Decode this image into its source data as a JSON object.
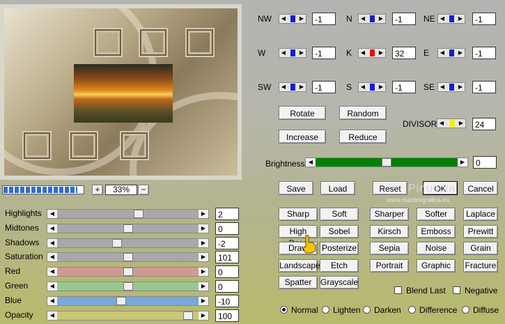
{
  "directions": [
    {
      "id": "nw",
      "label": "NW",
      "value": "-1",
      "color": "#1020d0"
    },
    {
      "id": "n",
      "label": "N",
      "value": "-1",
      "color": "#1020d0"
    },
    {
      "id": "ne",
      "label": "NE",
      "value": "-1",
      "color": "#1020d0"
    },
    {
      "id": "w",
      "label": "W",
      "value": "-1",
      "color": "#1020d0"
    },
    {
      "id": "k",
      "label": "K",
      "value": "32",
      "color": "#e01010"
    },
    {
      "id": "e",
      "label": "E",
      "value": "-1",
      "color": "#1020d0"
    },
    {
      "id": "sw",
      "label": "SW",
      "value": "-1",
      "color": "#1020d0"
    },
    {
      "id": "s",
      "label": "S",
      "value": "-1",
      "color": "#1020d0"
    },
    {
      "id": "se",
      "label": "SE",
      "value": "-1",
      "color": "#1020d0"
    }
  ],
  "actions": {
    "rotate": "Rotate",
    "random": "Random",
    "increase": "Increase",
    "reduce": "Reduce"
  },
  "divisor": {
    "label": "DIVISOR",
    "value": "24",
    "color": "#f0f000"
  },
  "brightness": {
    "label": "Brightness",
    "value": "0",
    "color": "#008000"
  },
  "zoom": {
    "plus": "+",
    "minus": "−",
    "value": "33%",
    "progress": 0.93
  },
  "dialog": {
    "save": "Save",
    "load": "Load",
    "reset": "Reset",
    "ok": "OK",
    "cancel": "Cancel"
  },
  "watermark": {
    "brand": "Pinuccia",
    "site": "www.maidiregrafica.eu"
  },
  "adjustments": [
    {
      "id": "highlights",
      "label": "Highlights",
      "value": "2",
      "track": "#a8a8a8",
      "pos": 0.58
    },
    {
      "id": "midtones",
      "label": "Midtones",
      "value": "0",
      "track": "#a8a8a8",
      "pos": 0.5
    },
    {
      "id": "shadows",
      "label": "Shadows",
      "value": "-2",
      "track": "#a8a8a8",
      "pos": 0.42
    },
    {
      "id": "saturation",
      "label": "Saturation",
      "value": "101",
      "track": "#a8a8a8",
      "pos": 0.5
    },
    {
      "id": "red",
      "label": "Red",
      "value": "0",
      "track": "#d09a94",
      "pos": 0.5
    },
    {
      "id": "green",
      "label": "Green",
      "value": "0",
      "track": "#98c890",
      "pos": 0.5
    },
    {
      "id": "blue",
      "label": "Blue",
      "value": "-10",
      "track": "#78a8d8",
      "pos": 0.45
    },
    {
      "id": "opacity",
      "label": "Opacity",
      "value": "100",
      "track": "#c8c878",
      "pos": 0.96
    }
  ],
  "presets": [
    [
      "Sharp",
      "Soft",
      "Sharper",
      "Softer",
      "Laplace"
    ],
    [
      "High Pass",
      "Sobel",
      "Kirsch",
      "Emboss",
      "Prewitt"
    ],
    [
      "Draw",
      "Posterize",
      "Sepia",
      "Noise",
      "Grain"
    ],
    [
      "Landscape",
      "Etch",
      "Portrait",
      "Graphic",
      "Fracture"
    ],
    [
      "Spatter",
      "Grayscale"
    ]
  ],
  "checkboxes": {
    "blend_last": "Blend Last",
    "negative": "Negative"
  },
  "modes": [
    "Normal",
    "Lighten",
    "Darken",
    "Difference",
    "Diffuse"
  ],
  "selected_mode": "Normal"
}
